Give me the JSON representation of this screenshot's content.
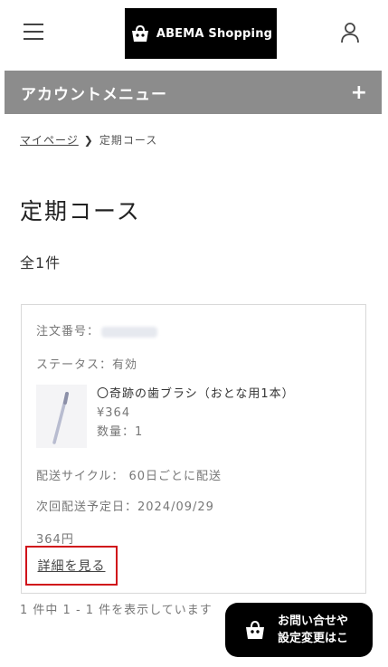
{
  "header": {
    "logo_text": "ABEMA Shopping",
    "menu_icon": "hamburger-menu-icon",
    "user_icon": "user-account-icon"
  },
  "account_menu": {
    "label": "アカウントメニュー",
    "toggle": "+"
  },
  "breadcrumb": {
    "items": [
      {
        "label": "マイページ"
      },
      {
        "label": "定期コース"
      }
    ]
  },
  "page": {
    "title": "定期コース",
    "count": "全1件"
  },
  "subscription": {
    "order_label": "注文番号：",
    "status": "ステータス：有効",
    "product_name": "〇奇跡の歯ブラシ（おとな用1本）",
    "price": "¥364",
    "quantity": "数量：1",
    "delivery_cycle": "配送サイクル： 60日ごとに配送",
    "next_delivery": "次回配送予定日：2024/09/29",
    "total": "364円",
    "details_link": "詳細を見る"
  },
  "pagination": {
    "text": "1 件中 1 - 1 件を表示しています"
  },
  "contact_button": {
    "line1": "お問い合せや",
    "line2": "設定変更はこ"
  },
  "colors": {
    "account_bar": "#8c8c8c",
    "highlight_border": "#d0101a",
    "logo_bg": "#000000"
  }
}
